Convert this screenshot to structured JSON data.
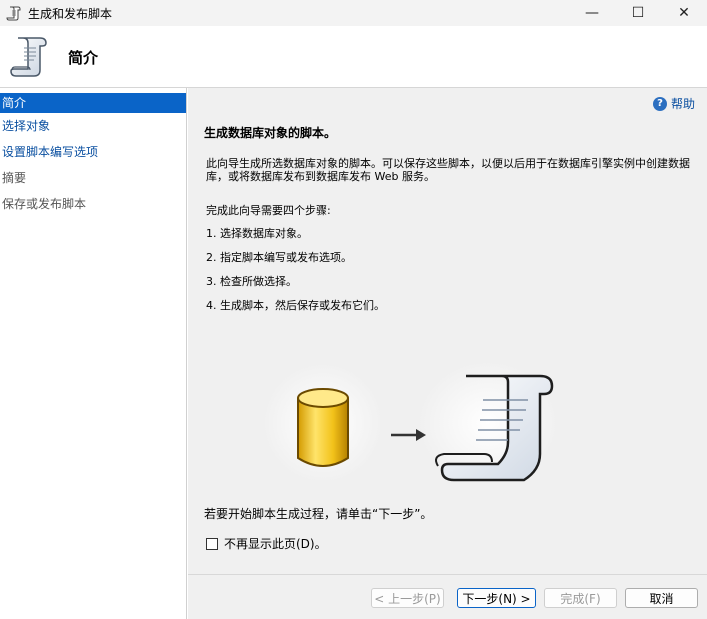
{
  "window": {
    "title": "生成和发布脚本",
    "minimize": "—",
    "maximize": "☐",
    "close": "✕"
  },
  "header": {
    "title": "简介"
  },
  "sidebar": {
    "items": [
      {
        "label": "简介"
      },
      {
        "label": "选择对象"
      },
      {
        "label": "设置脚本编写选项"
      },
      {
        "label": "摘要"
      },
      {
        "label": "保存或发布脚本"
      }
    ]
  },
  "main": {
    "help_label": "帮助",
    "title": "生成数据库对象的脚本。",
    "description": "此向导生成所选数据库对象的脚本。可以保存这些脚本，以便以后用于在数据库引擎实例中创建数据库，或将数据库发布到数据库发布 Web 服务。",
    "steps_intro": "完成此向导需要四个步骤:",
    "steps": [
      "1.  选择数据库对象。",
      " 2.  指定脚本编写或发布选项。",
      "3.  检查所做选择。",
      "4.  生成脚本，然后保存或发布它们。"
    ],
    "start_hint": "若要开始脚本生成过程，请单击“下一步”。",
    "dont_show": "不再显示此页(D)。"
  },
  "buttons": {
    "back": "< 上一步(P)",
    "next": "下一步(N) >",
    "finish": "完成(F)",
    "cancel": "取消"
  }
}
